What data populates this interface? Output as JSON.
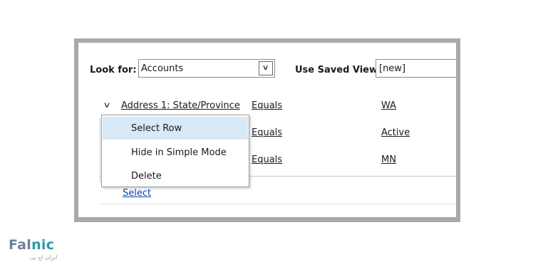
{
  "toolbar": {
    "look_for_label": "Look for:",
    "look_for_value": "Accounts",
    "saved_view_label": "Use Saved View:",
    "saved_view_value": "[new]"
  },
  "criteria": {
    "rows": [
      {
        "field": "Address 1: State/Province",
        "operator": "Equals",
        "value": "WA"
      },
      {
        "field": "",
        "operator": "Equals",
        "value": "Active"
      },
      {
        "field": "",
        "operator": "Equals",
        "value": "MN"
      }
    ],
    "select_link": "Select"
  },
  "context_menu": {
    "items": [
      "Select Row",
      "Hide in Simple Mode",
      "Delete"
    ]
  },
  "logo": {
    "part1": "Fal",
    "part2": "nic",
    "subtitle": "ایران اچ پی"
  }
}
